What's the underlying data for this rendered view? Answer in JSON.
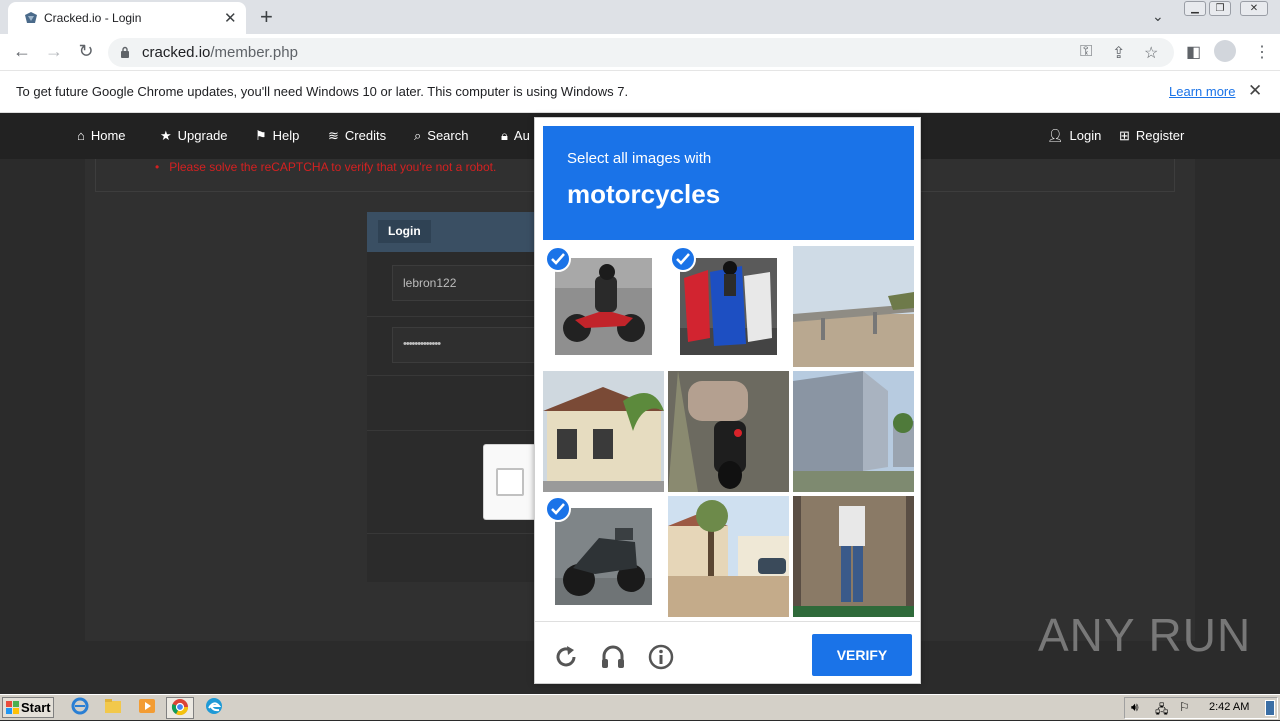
{
  "browser": {
    "tab_title": "Cracked.io - Login",
    "url_host": "cracked.io",
    "url_path": "/member.php",
    "infobar_text": "To get future Google Chrome updates, you'll need Windows 10 or later. This computer is using Windows 7.",
    "infobar_link": "Learn more"
  },
  "site": {
    "nav_left": [
      "Home",
      "Upgrade",
      "Help",
      "Credits",
      "Search",
      "Au"
    ],
    "nav_right": [
      "Login",
      "Register"
    ],
    "error_message": "Please solve the reCAPTCHA to verify that you're not a robot.",
    "login_title": "Login",
    "username_value": "lebron122",
    "password_value": "•••••••••••••"
  },
  "captcha": {
    "prompt": "Select all images with",
    "target": "motorcycles",
    "tiles": [
      {
        "name": "motorcycle-rider",
        "selected": true
      },
      {
        "name": "parked-scooters",
        "selected": true
      },
      {
        "name": "overpass",
        "selected": false
      },
      {
        "name": "house-palm",
        "selected": false
      },
      {
        "name": "motorcycle-rear",
        "selected": false
      },
      {
        "name": "office-building",
        "selected": false
      },
      {
        "name": "parked-motorcycle",
        "selected": true
      },
      {
        "name": "dirt-street",
        "selected": false
      },
      {
        "name": "storefront",
        "selected": false
      }
    ],
    "verify_label": "VERIFY"
  },
  "watermark": "ANY RUN",
  "taskbar": {
    "start_label": "Start",
    "clock": "2:42 AM"
  },
  "colors": {
    "recaptcha_blue": "#1a73e8",
    "nav_bg": "#222222",
    "error_red": "#d32121"
  }
}
